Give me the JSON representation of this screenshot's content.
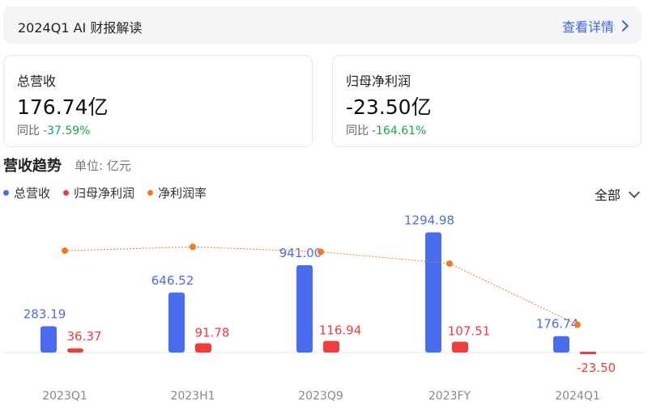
{
  "banner": {
    "title": "2024Q1 AI 财报解读",
    "link_label": "查看详情"
  },
  "cards": [
    {
      "label": "总营收",
      "value": "176.74亿",
      "change_label": "同比",
      "change": "-37.59%"
    },
    {
      "label": "归母净利润",
      "value": "-23.50亿",
      "change_label": "同比",
      "change": "-164.61%"
    }
  ],
  "section": {
    "title": "营收趋势",
    "unit": "单位: 亿元"
  },
  "filter": {
    "label": "全部"
  },
  "colors": {
    "revenue": "#4a6cf0",
    "profit": "#f23c3c",
    "margin": "#f57a1f",
    "positive_change": "#1aa55a"
  },
  "chart_data": {
    "type": "bar",
    "categories": [
      "2023Q1",
      "2023H1",
      "2023Q9",
      "2023FY",
      "2024Q1"
    ],
    "series": [
      {
        "name": "总营收",
        "type": "bar",
        "values": [
          283.19,
          646.52,
          941.0,
          1294.98,
          176.74
        ],
        "labels": [
          "283.19",
          "646.52",
          "941.00",
          "1294.98",
          "176.74"
        ]
      },
      {
        "name": "归母净利润",
        "type": "bar",
        "values": [
          36.37,
          91.78,
          116.94,
          107.51,
          -23.5
        ],
        "labels": [
          "36.37",
          "91.78",
          "116.94",
          "107.51",
          "-23.50"
        ]
      },
      {
        "name": "净利润率",
        "type": "line",
        "values": [
          12.84,
          14.2,
          12.43,
          8.3,
          -13.3
        ]
      }
    ],
    "legend_position": "top-left",
    "grid": false
  }
}
